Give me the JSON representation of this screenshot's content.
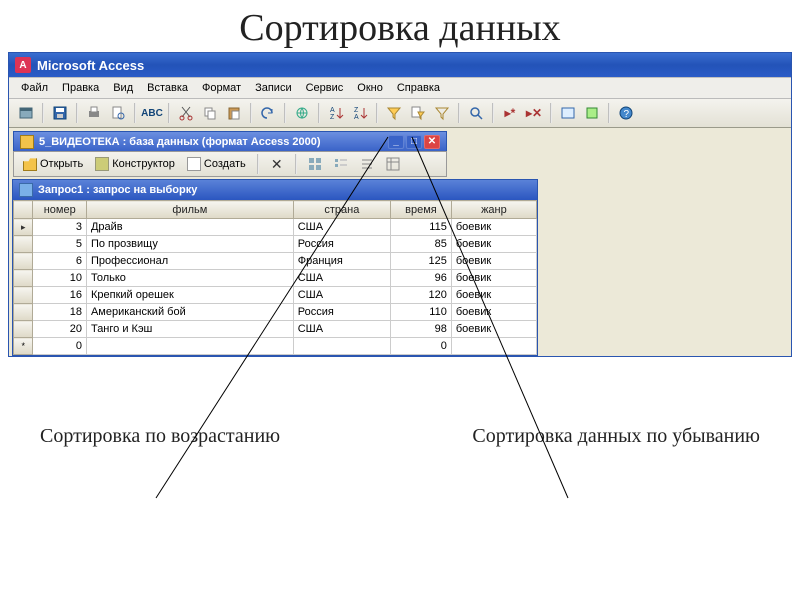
{
  "slide_title": "Сортировка данных",
  "app_title": "Microsoft Access",
  "menu": [
    "Файл",
    "Правка",
    "Вид",
    "Вставка",
    "Формат",
    "Записи",
    "Сервис",
    "Окно",
    "Справка"
  ],
  "db_window_title": "5_ВИДЕОТЕКА : база данных (формат Access 2000)",
  "db_toolbar": {
    "open": "Открыть",
    "design": "Конструктор",
    "new": "Создать"
  },
  "query_title": "Запрос1 : запрос на выборку",
  "columns": {
    "num": "номер",
    "film": "фильм",
    "country": "страна",
    "time": "время",
    "genre": "жанр"
  },
  "rows": [
    {
      "num": "3",
      "film": "Драйв",
      "country": "США",
      "time": "115",
      "genre": "боевик"
    },
    {
      "num": "5",
      "film": "По прозвищу",
      "country": "Россия",
      "time": "85",
      "genre": "боевик"
    },
    {
      "num": "6",
      "film": "Профессионал",
      "country": "Франция",
      "time": "125",
      "genre": "боевик"
    },
    {
      "num": "10",
      "film": "Только",
      "country": "США",
      "time": "96",
      "genre": "боевик"
    },
    {
      "num": "16",
      "film": "Крепкий орешек",
      "country": "США",
      "time": "120",
      "genre": "боевик"
    },
    {
      "num": "18",
      "film": "Американский бой",
      "country": "Россия",
      "time": "110",
      "genre": "боевик"
    },
    {
      "num": "20",
      "film": "Танго и Кэш",
      "country": "США",
      "time": "98",
      "genre": "боевик"
    }
  ],
  "new_row": {
    "num": "0",
    "time": "0"
  },
  "callouts": {
    "asc": "Сортировка по возрастанию",
    "desc": "Сортировка данных по убыванию"
  }
}
